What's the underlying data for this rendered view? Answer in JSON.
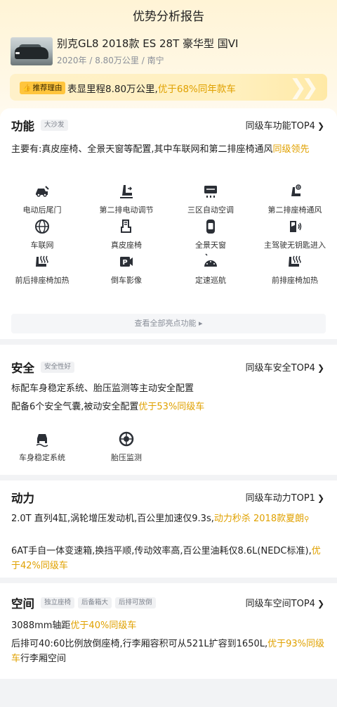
{
  "header": {
    "title": "优势分析报告"
  },
  "car": {
    "name": "别克GL8 2018款 ES 28T 豪华型 国VI",
    "meta": "2020年 / 8.80万公里 / 南宁"
  },
  "reason": {
    "tag": "推荐理由",
    "text_prefix": "表显里程8.80万公里,",
    "text_highlight": "优于68%同年款车"
  },
  "function": {
    "title": "功能",
    "tags": [
      "大沙发"
    ],
    "link": "同级车功能TOP4",
    "desc_prefix": "主要有:真皮座椅、全景天窗等配置,其中车联网和第二排座椅通风",
    "desc_highlight": "同级领先",
    "features": [
      {
        "label": "电动后尾门",
        "icon": "power-tailgate-icon"
      },
      {
        "label": "第二排电动调节",
        "icon": "seat-adjust-icon"
      },
      {
        "label": "三区自动空调",
        "icon": "climate-control-icon"
      },
      {
        "label": "第二排座椅通风",
        "icon": "seat-ventilation-icon"
      },
      {
        "label": "车联网",
        "icon": "globe-icon"
      },
      {
        "label": "真皮座椅",
        "icon": "leather-seat-icon"
      },
      {
        "label": "全景天窗",
        "icon": "sunroof-icon"
      },
      {
        "label": "主驾驶无钥匙进入",
        "icon": "keyless-entry-icon"
      },
      {
        "label": "前后排座椅加热",
        "icon": "seat-heating-icon"
      },
      {
        "label": "倒车影像",
        "icon": "parking-camera-icon"
      },
      {
        "label": "定速巡航",
        "icon": "cruise-control-icon"
      },
      {
        "label": "前排座椅加热",
        "icon": "seat-heating-icon"
      }
    ],
    "more": "查看全部亮点功能 ▸"
  },
  "safety": {
    "title": "安全",
    "tags": [
      "安全性好"
    ],
    "link": "同级车安全TOP4",
    "line1": "标配车身稳定系统、胎压监测等主动安全配置",
    "line2_prefix": "配备6个安全气囊,被动安全配置",
    "line2_highlight": "优于53%同级车",
    "features": [
      {
        "label": "车身稳定系统",
        "icon": "stability-control-icon"
      },
      {
        "label": "胎压监测",
        "icon": "tire-pressure-icon"
      }
    ]
  },
  "power": {
    "title": "动力",
    "link": "同级车动力TOP1",
    "line1_prefix": "2.0T 直列4缸,涡轮增压发动机,百公里加速仅9.3s,",
    "line1_highlight": "动力秒杀 2018款夏朗",
    "line2_prefix": "6AT手自一体变速箱,换挡平顺,传动效率高,百公里油耗仅8.6L(NEDC标准),",
    "line2_highlight": "优于42%同级车"
  },
  "space": {
    "title": "空间",
    "tags": [
      "独立座椅",
      "后备箱大",
      "后排可放倒"
    ],
    "link": "同级车空间TOP4",
    "line1_prefix": "3088mm轴距",
    "line1_highlight": "优于40%同级车",
    "line2_prefix": "后排可40:60比例放倒座椅,行李厢容积可从521L扩容到1650L,",
    "line2_highlight": "优于93%同级车",
    "line2_suffix": "行李厢空间"
  },
  "colors": {
    "accent": "#e0a100",
    "tag_bg": "#ffc53d",
    "header_bg": "#fff4d6"
  }
}
